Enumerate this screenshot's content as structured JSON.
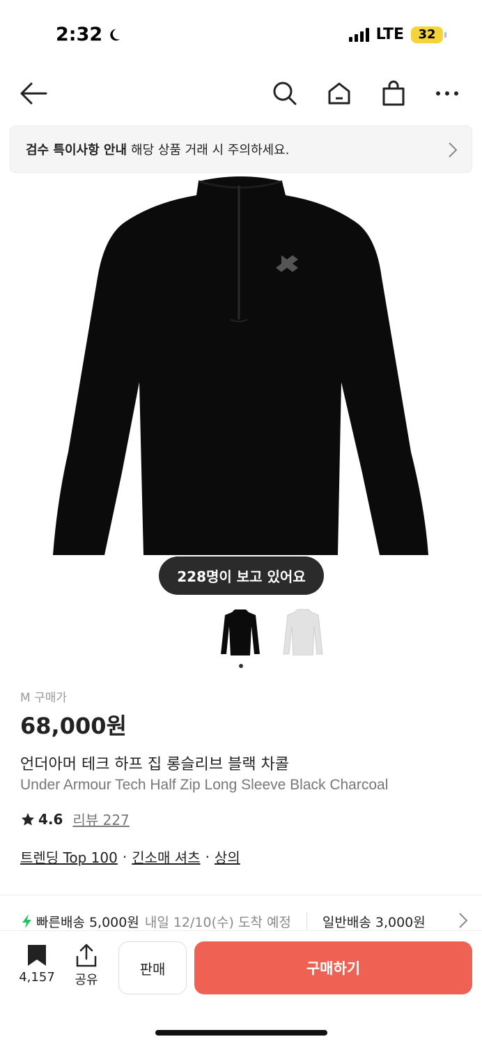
{
  "status": {
    "time": "2:32",
    "network": "LTE",
    "battery": "32"
  },
  "notice": {
    "title": "검수 특이사항 안내",
    "text": "해당 상품 거래 시 주의하세요."
  },
  "viewers": "228명이 보고 있어요",
  "product": {
    "price_label": "M 구매가",
    "price": "68,000원",
    "name_ko": "언더아머 테크 하프 집 롱슬리브 블랙 차콜",
    "name_en": "Under Armour Tech Half Zip Long Sleeve Black Charcoal",
    "rating": "4.6",
    "review": "리뷰 227",
    "tags": [
      "트렌딩 Top 100",
      "긴소매 셔츠",
      "상의"
    ],
    "tag_separator": "·"
  },
  "delivery": {
    "fast_label": "빠른배송 5,000원",
    "fast_eta": "내일 12/10(수) 도착 예정",
    "normal_label": "일반배송 3,000원"
  },
  "bottom": {
    "bookmark_count": "4,157",
    "share_label": "공유",
    "sell_label": "판매",
    "buy_label": "구매하기"
  },
  "colors": {
    "buy": "#ef6253",
    "fast_icon": "#22c35e",
    "badge": "#2b2b2b"
  }
}
